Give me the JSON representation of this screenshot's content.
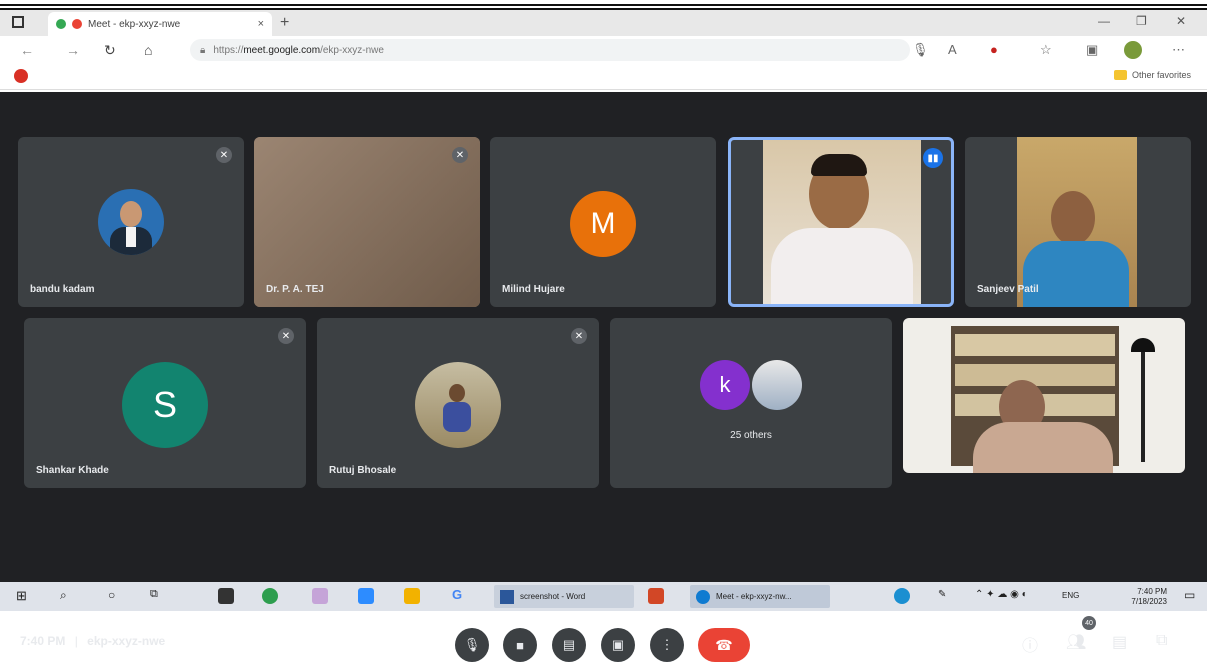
{
  "browser": {
    "tab_title": "Meet - ekp-xxyz-nwe",
    "tab_close": "×",
    "new_tab": "+",
    "url_prefix": "https://",
    "url_host": "meet.google.com",
    "url_path": "/ekp-xxyz-nwe",
    "bookmark_folder": "Other favorites",
    "window_controls": [
      "—",
      "❐",
      "✕"
    ]
  },
  "meet": {
    "tiles_row1": [
      {
        "name": "bandu kadam",
        "type": "photo-avatar",
        "muted": true
      },
      {
        "name": "Dr. P. A. TEJ",
        "type": "video-blank",
        "muted": true
      },
      {
        "name": "Milind Hujare",
        "type": "letter-avatar",
        "letter": "M",
        "avatar_color": "#e8710a",
        "muted": false
      },
      {
        "name": "",
        "type": "video",
        "speaking": true
      },
      {
        "name": "Sanjeev Patil",
        "type": "video",
        "muted": false
      }
    ],
    "tiles_row2": [
      {
        "name": "Shankar Khade",
        "type": "letter-avatar",
        "letter": "S",
        "avatar_color": "#12846f",
        "muted": true
      },
      {
        "name": "Rutuj Bhosale",
        "type": "photo-avatar",
        "muted": true
      },
      {
        "name": "",
        "type": "others",
        "letter": "k",
        "avatar_color": "#8430ce",
        "others_label": "25 others"
      },
      {
        "name": "",
        "type": "video"
      }
    ],
    "time": "7:40 PM",
    "separator": "|",
    "meeting_code": "ekp-xxyz-nwe",
    "participants_count": "40",
    "hangup_icon": "☎",
    "accent": "#1a73e8",
    "hangup_color": "#ea4335"
  },
  "taskbar": {
    "word_label": "screenshot - Word",
    "edge_label": "Meet - ekp-xxyz-nw...",
    "lang": "ENG",
    "clock_time": "7:40 PM",
    "clock_date": "7/18/2023"
  }
}
